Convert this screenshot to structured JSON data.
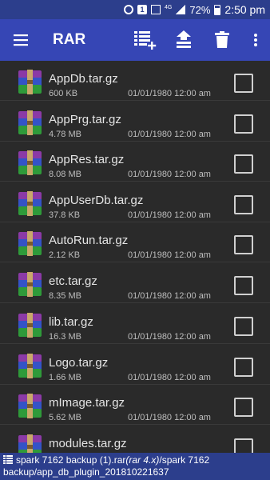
{
  "status_bar": {
    "battery": "72%",
    "time": "2:50 pm",
    "network": "4G"
  },
  "app_bar": {
    "title": "RAR",
    "actions": [
      "select-all-icon",
      "extract-icon",
      "delete-icon",
      "more-vert-icon"
    ]
  },
  "files": [
    {
      "name": "AppDb.tar.gz",
      "size": "600 KB",
      "date": "01/01/1980 12:00 am"
    },
    {
      "name": "AppPrg.tar.gz",
      "size": "4.78 MB",
      "date": "01/01/1980 12:00 am"
    },
    {
      "name": "AppRes.tar.gz",
      "size": "8.08 MB",
      "date": "01/01/1980 12:00 am"
    },
    {
      "name": "AppUserDb.tar.gz",
      "size": "37.8 KB",
      "date": "01/01/1980 12:00 am"
    },
    {
      "name": "AutoRun.tar.gz",
      "size": "2.12 KB",
      "date": "01/01/1980 12:00 am"
    },
    {
      "name": "etc.tar.gz",
      "size": "8.35 MB",
      "date": "01/01/1980 12:00 am"
    },
    {
      "name": "lib.tar.gz",
      "size": "16.3 MB",
      "date": "01/01/1980 12:00 am"
    },
    {
      "name": "Logo.tar.gz",
      "size": "1.66 MB",
      "date": "01/01/1980 12:00 am"
    },
    {
      "name": "mImage.tar.gz",
      "size": "5.62 MB",
      "date": "01/01/1980 12:00 am"
    },
    {
      "name": "modules.tar.gz",
      "size": "",
      "date": ""
    }
  ],
  "path_bar": {
    "archive": "spark 7162 backup (1).rar",
    "version": "(rar 4.x)",
    "path": "/spark 7162 backup/app_db_plugin_201810221637"
  },
  "colors": {
    "app_bar": "#3646b5",
    "status_bar": "#2c3e8c",
    "background": "#2a2a2a"
  }
}
